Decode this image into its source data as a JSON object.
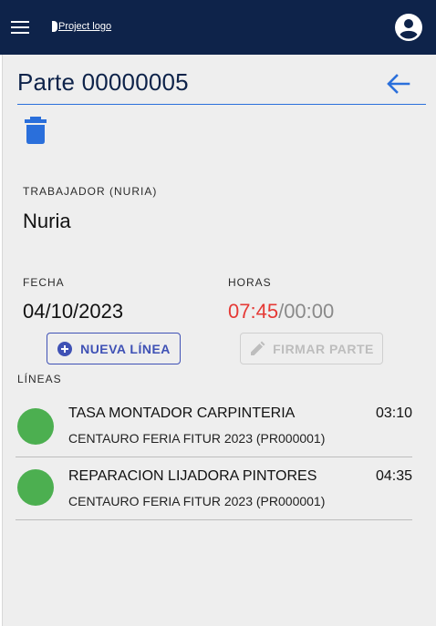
{
  "header": {
    "logo_alt": "Project logo",
    "menu_icon": "hamburger-icon",
    "account_icon": "account-circle-icon"
  },
  "page": {
    "title": "Parte 00000005",
    "back_icon": "arrow-left-icon",
    "delete_icon": "trash-icon"
  },
  "worker": {
    "label": "TRABAJADOR (NURIA)",
    "value": "Nuria"
  },
  "date": {
    "label": "FECHA",
    "value": "04/10/2023"
  },
  "hours": {
    "label": "HORAS",
    "done": "07:45",
    "separator": "/",
    "total": "00:00"
  },
  "actions": {
    "new_line_label": "NUEVA LÍNEA",
    "sign_label": "FIRMAR PARTE"
  },
  "lines": {
    "label": "LÍNEAS",
    "items": [
      {
        "title": "TASA MONTADOR CARPINTERIA",
        "project": "CENTAURO FERIA FITUR 2023 (PR000001)",
        "time": "03:10"
      },
      {
        "title": "REPARACION LIJADORA PINTORES",
        "project": "CENTAURO FERIA FITUR 2023 (PR000001)",
        "time": "04:35"
      }
    ]
  },
  "colors": {
    "header_bg": "#0e234a",
    "accent": "#2a6fdb",
    "hours_done": "#e53935",
    "status_dot": "#4caf50"
  }
}
